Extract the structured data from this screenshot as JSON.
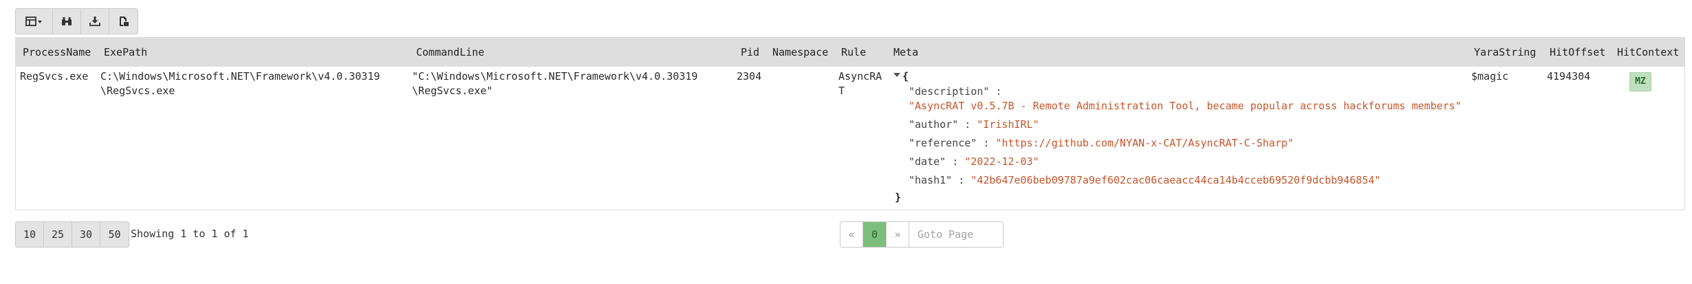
{
  "toolbar": {
    "icons": [
      "columns-dropdown-icon",
      "binoculars-icon",
      "download-icon",
      "export-csv-icon"
    ]
  },
  "table": {
    "headers": {
      "process_name": "ProcessName",
      "exe_path": "ExePath",
      "command_line": "CommandLine",
      "pid": "Pid",
      "namespace": "Namespace",
      "rule": "Rule",
      "meta": "Meta",
      "yara_string": "YaraString",
      "hit_offset": "HitOffset",
      "hit_context": "HitContext"
    },
    "row": {
      "process_name": "RegSvcs.exe",
      "exe_path": "C:\\Windows\\Microsoft.NET\\Framework\\v4.0.30319\n\\RegSvcs.exe",
      "command_line": "\"C:\\Windows\\Microsoft.NET\\Framework\\v4.0.30319\n\\RegSvcs.exe\"",
      "pid": "2304",
      "namespace": "",
      "rule": "AsyncRAT",
      "meta": {
        "open_brace": "{",
        "close_brace": "}",
        "entries": [
          {
            "key": "\"description\"",
            "value": "\"AsyncRAT v0.5.7B - Remote Administration Tool, became popular across hackforums members\""
          },
          {
            "key": "\"author\"",
            "value": "\"IrishIRL\""
          },
          {
            "key": "\"reference\"",
            "value": "\"https://github.com/NYAN-x-CAT/AsyncRAT-C-Sharp\""
          },
          {
            "key": "\"date\"",
            "value": "\"2022-12-03\""
          },
          {
            "key": "\"hash1\"",
            "value": "\"42b647e06beb09787a9ef602cac06caeacc44ca14b4cceb69520f9dcbb946854\""
          }
        ]
      },
      "yara_string": "$magic",
      "hit_offset": "4194304",
      "hit_context": "MZ"
    }
  },
  "footer": {
    "page_sizes": [
      "10",
      "25",
      "30",
      "50"
    ],
    "showing": "Showing 1 to 1 of 1",
    "pager": {
      "prev": "«",
      "current": "0",
      "next": "»",
      "goto_placeholder": "Goto Page"
    }
  },
  "colors": {
    "header_bg": "#dedede",
    "string_value": "#c8552a",
    "active_page": "#7cbf7c",
    "hit_context_badge": "#bfe0bf"
  }
}
